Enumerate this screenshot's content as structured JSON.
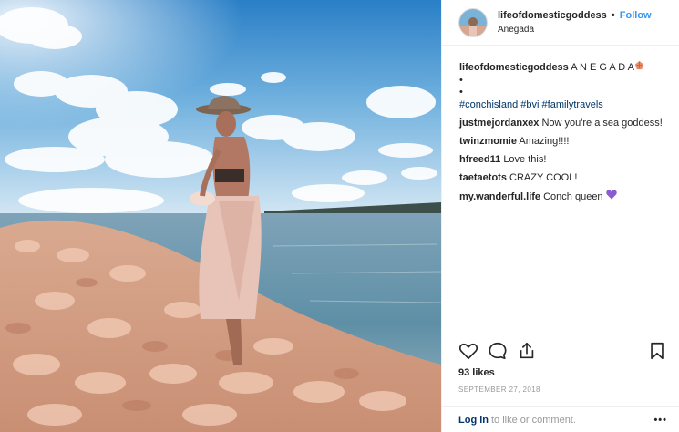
{
  "header": {
    "username": "lifeofdomesticgoddess",
    "separator": "•",
    "follow_label": "Follow",
    "location": "Anegada"
  },
  "caption": {
    "username": "lifeofdomesticgoddess",
    "text": "A N E G A D A",
    "emoji": "shell-emoji",
    "bullet1": "•",
    "bullet2": "•",
    "hashtags": [
      "#conchisland",
      "#bvi",
      "#familytravels"
    ]
  },
  "comments": [
    {
      "user": "justmejordanxex",
      "text": "Now you're a sea goddess!"
    },
    {
      "user": "twinzmomie",
      "text": "Amazing!!!!"
    },
    {
      "user": "hfreed11",
      "text": "Love this!"
    },
    {
      "user": "taetaetots",
      "text": "CRAZY COOL!"
    },
    {
      "user": "my.wanderful.life",
      "text": "Conch queen",
      "emoji": "purple-heart"
    }
  ],
  "actions": {
    "likes": "93 likes",
    "date": "SEPTEMBER 27, 2018",
    "icons": [
      "heart-icon",
      "comment-icon",
      "share-icon",
      "bookmark-icon"
    ]
  },
  "footer": {
    "login_label": "Log in",
    "prompt": "to like or comment.",
    "more_label": "•••"
  },
  "colors": {
    "link_blue": "#3897f0",
    "hashtag": "#003569",
    "muted": "#999999",
    "emoji_heart": "#8a5cd0",
    "emoji_shell": "#e8896a"
  }
}
